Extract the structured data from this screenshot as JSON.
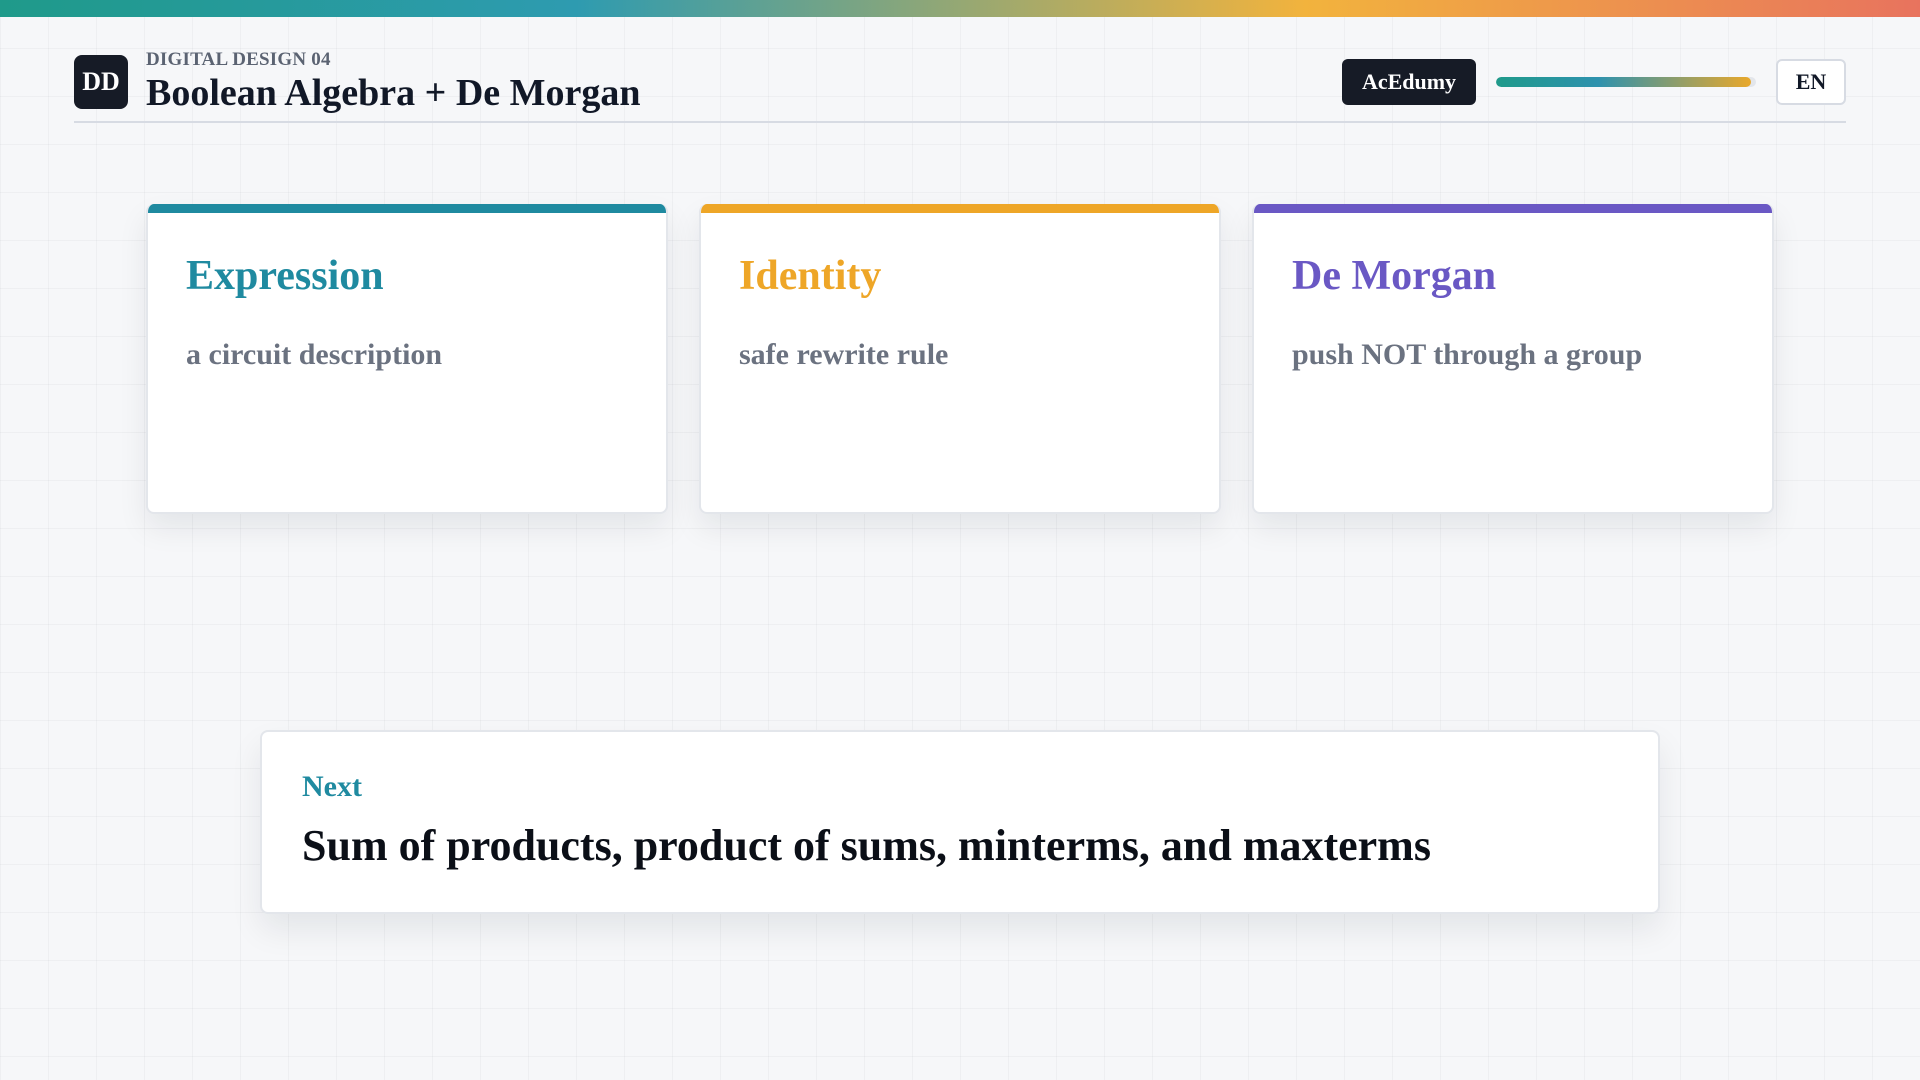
{
  "header": {
    "logo": "DD",
    "kicker": "DIGITAL DESIGN 04",
    "title": "Boolean Algebra + De Morgan",
    "brand": "AcEdumy",
    "language": "EN",
    "progress_percent": 98
  },
  "cards": [
    {
      "title": "Expression",
      "description": "a circuit description",
      "accent": "#1f8aa0"
    },
    {
      "title": "Identity",
      "description": "safe rewrite rule",
      "accent": "#eea627"
    },
    {
      "title": "De Morgan",
      "description": "push NOT through a group",
      "accent": "#6a58c4"
    }
  ],
  "next": {
    "label": "Next",
    "title": "Sum of products, product of sums, minterms, and maxterms",
    "label_color": "#1f8aa0"
  },
  "colors": {
    "dark": "#161b26",
    "muted_text": "#6b7280"
  }
}
